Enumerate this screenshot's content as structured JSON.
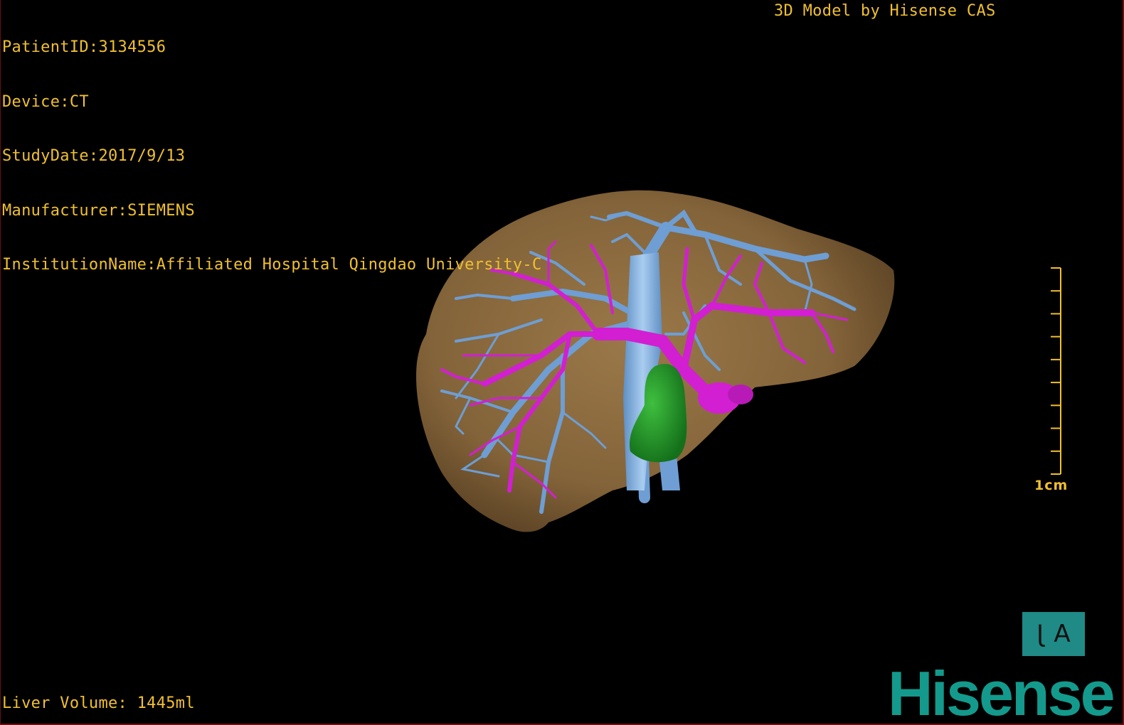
{
  "patient_info": {
    "patient_id": "PatientID:3134556",
    "device": "Device:CT",
    "study_date": "StudyDate:2017/9/13",
    "manufacturer": "Manufacturer:SIEMENS",
    "institution": "InstitutionName:Affiliated Hospital Qingdao University-C"
  },
  "model_credit": "3D Model by Hisense CAS",
  "liver_volume": "Liver Volume: 1445ml",
  "scale_bar": {
    "label": "1cm",
    "ticks": 9
  },
  "orientation_cube": {
    "left_glyph": "J",
    "right_glyph": "A"
  },
  "brand": "Hisense",
  "colors": {
    "overlay_text": "#f0c030",
    "liver": "#8a6a3f",
    "hepatic_vein": "#6e9ed4",
    "portal_vein": "#d21fd2",
    "lesion": "#1e8c22",
    "brand": "#139a8c",
    "orientation_cube": "#1f8a86"
  }
}
